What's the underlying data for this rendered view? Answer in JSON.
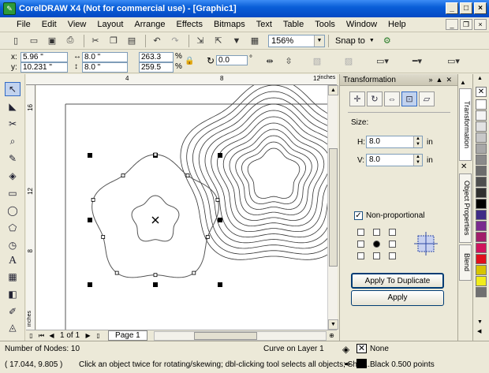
{
  "window": {
    "title": "CorelDRAW X4 (Not for commercial use) - [Graphic1]"
  },
  "menu": [
    "File",
    "Edit",
    "View",
    "Layout",
    "Arrange",
    "Effects",
    "Bitmaps",
    "Text",
    "Table",
    "Tools",
    "Window",
    "Help"
  ],
  "toolbar": {
    "zoom": "156%",
    "snap_to": "Snap to"
  },
  "property_bar": {
    "x": "5.96 \"",
    "y": "10.231 \"",
    "width": "8.0 \"",
    "height": "8.0 \"",
    "scale_x": "263.3",
    "scale_y": "259.5",
    "percent": "%",
    "rotation": "0.0",
    "degree": "°"
  },
  "rulers": {
    "h_ticks": [
      "4",
      "8",
      "12"
    ],
    "v_ticks": [
      "16",
      "12",
      "8"
    ],
    "unit": "inches"
  },
  "page_nav": {
    "counter": "1 of 1",
    "page_tab": "Page 1"
  },
  "docker": {
    "title": "Transformation",
    "size_label": "Size:",
    "h_label": "H:",
    "h_value": "8.0",
    "h_unit": "in",
    "v_label": "V:",
    "v_value": "8.0",
    "v_unit": "in",
    "non_proportional": "Non-proportional",
    "apply_dup": "Apply To Duplicate",
    "apply": "Apply"
  },
  "side_tabs": [
    "Transformation",
    "Object Properties",
    "Blend"
  ],
  "palette_colors": [
    "#ffffff",
    "#f4f4f4",
    "#e2e2e2",
    "#c8c8c8",
    "#a8a8a8",
    "#8a8a8a",
    "#6c6c6c",
    "#4e4e4e",
    "#303030",
    "#000000",
    "#3e2b86",
    "#7a2a8f",
    "#a11e6a",
    "#d0145c",
    "#e10f1c",
    "#d7c400",
    "#f1ec1b",
    "#707070"
  ],
  "status": {
    "nodes": "Number of Nodes: 10",
    "layer": "Curve on Layer 1",
    "fill": "None",
    "coords": "( 17.044, 9.805 )",
    "hint": "Click an object twice for rotating/skewing; dbl-clicking tool selects all objects; Shift...",
    "outline": "Black  0.500 points"
  }
}
